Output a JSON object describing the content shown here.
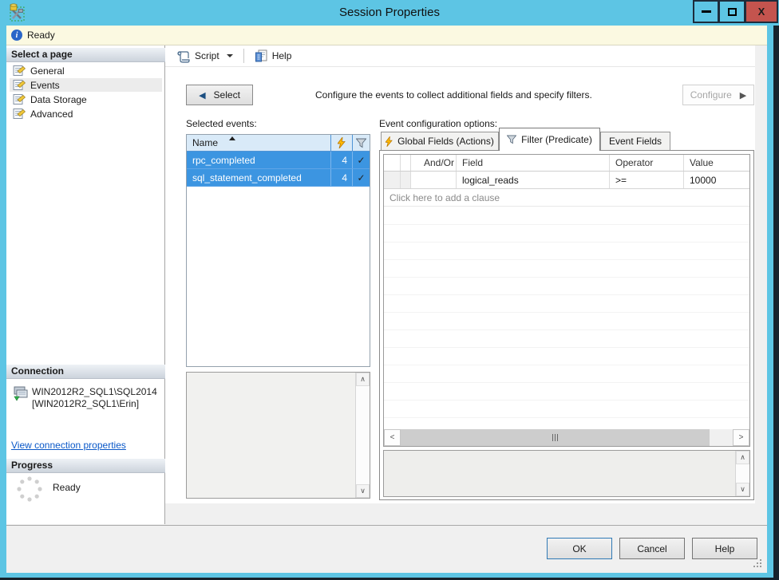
{
  "window": {
    "title": "Session Properties",
    "close_glyph": "X"
  },
  "status_bar": {
    "message": "Ready"
  },
  "toolbar": {
    "script": "Script",
    "help": "Help"
  },
  "sidebar": {
    "header": "Select a page",
    "pages": [
      {
        "label": "General"
      },
      {
        "label": "Events"
      },
      {
        "label": "Data Storage"
      },
      {
        "label": "Advanced"
      }
    ],
    "selected_page": "Events"
  },
  "connection": {
    "header": "Connection",
    "server": "WIN2012R2_SQL1\\SQL2014",
    "login": "[WIN2012R2_SQL1\\Erin]",
    "link": "View connection properties"
  },
  "progress": {
    "header": "Progress",
    "status": "Ready"
  },
  "events_page": {
    "select_button": "Select",
    "select_arrow": "◀",
    "instruction": "Configure the events to collect additional fields and specify filters.",
    "configure_button": "Configure",
    "configure_arrow": "▶",
    "selected_events_label": "Selected events:",
    "event_table": {
      "name_header": "Name",
      "check_glyph": "✓",
      "rows": [
        {
          "name": "rpc_completed",
          "count": "4"
        },
        {
          "name": "sql_statement_completed",
          "count": "4"
        }
      ]
    },
    "config_label": "Event configuration options:",
    "tabs": [
      {
        "label": "Global Fields (Actions)"
      },
      {
        "label": "Filter (Predicate)"
      },
      {
        "label": "Event Fields"
      }
    ],
    "active_tab": "Filter (Predicate)",
    "filter_grid": {
      "headers": {
        "and_or": "And/Or",
        "field": "Field",
        "operator": "Operator",
        "value": "Value"
      },
      "rows": [
        {
          "and_or": "",
          "field": "logical_reads",
          "operator": ">=",
          "value": "10000"
        }
      ],
      "add_clause": "Click here to add a clause"
    }
  },
  "footer": {
    "ok": "OK",
    "cancel": "Cancel",
    "help": "Help"
  },
  "scrollbars": {
    "up": "∧",
    "down": "∨",
    "left": "<",
    "right": ">"
  },
  "colors": {
    "titlebar": "#5dc5e4",
    "window_border": "#5dc5e4",
    "close_button": "#c4544e",
    "status_bar_bg": "#fbf9e1",
    "header_cell_bg": "#d9eaf8",
    "row_selected": "#3c95e1",
    "link": "#0a58c8",
    "disabled_text": "#a6a6a6",
    "ok_focus": "#3079b5"
  }
}
